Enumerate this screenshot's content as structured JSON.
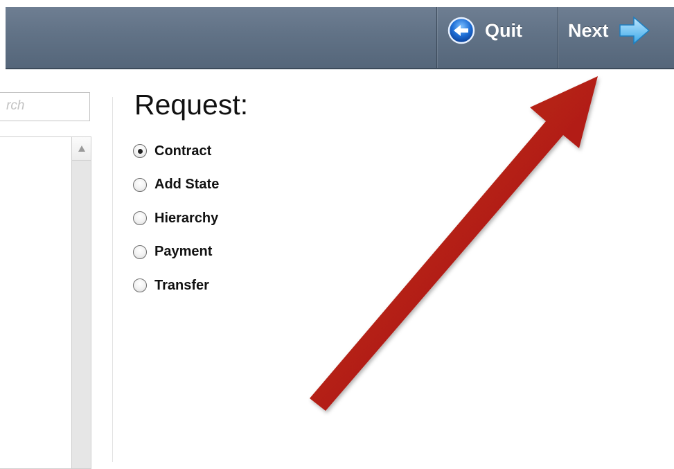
{
  "toolbar": {
    "quit_label": "Quit",
    "next_label": "Next",
    "quit_icon": "back-arrow-circle-icon",
    "next_icon": "right-arrow-icon",
    "background": "#617286"
  },
  "sidebar": {
    "search_placeholder_visible": "rch"
  },
  "main": {
    "title": "Request:",
    "options": [
      {
        "label": "Contract",
        "selected": true
      },
      {
        "label": "Add State",
        "selected": false
      },
      {
        "label": "Hierarchy",
        "selected": false
      },
      {
        "label": "Payment",
        "selected": false
      },
      {
        "label": "Transfer",
        "selected": false
      }
    ]
  },
  "annotation": {
    "type": "red-arrow",
    "points_to": "next-button",
    "color": "#b71c10"
  }
}
